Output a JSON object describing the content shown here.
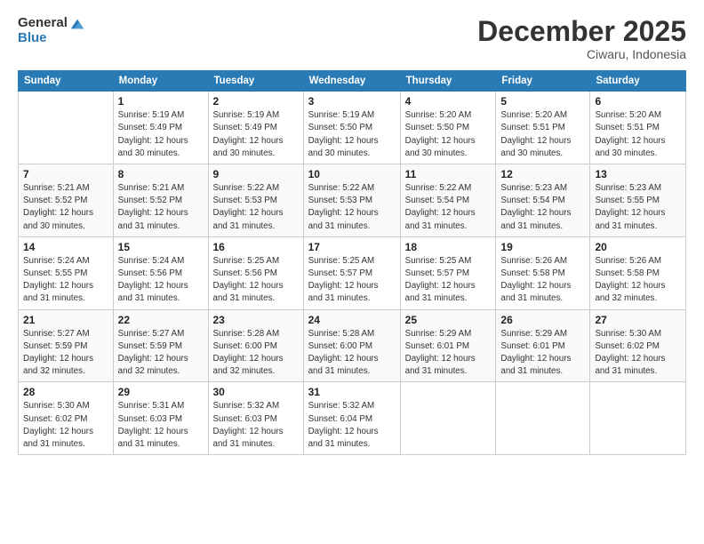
{
  "logo": {
    "general": "General",
    "blue": "Blue"
  },
  "header": {
    "month": "December 2025",
    "location": "Ciwaru, Indonesia"
  },
  "weekdays": [
    "Sunday",
    "Monday",
    "Tuesday",
    "Wednesday",
    "Thursday",
    "Friday",
    "Saturday"
  ],
  "weeks": [
    [
      {
        "day": "",
        "info": ""
      },
      {
        "day": "1",
        "info": "Sunrise: 5:19 AM\nSunset: 5:49 PM\nDaylight: 12 hours\nand 30 minutes."
      },
      {
        "day": "2",
        "info": "Sunrise: 5:19 AM\nSunset: 5:49 PM\nDaylight: 12 hours\nand 30 minutes."
      },
      {
        "day": "3",
        "info": "Sunrise: 5:19 AM\nSunset: 5:50 PM\nDaylight: 12 hours\nand 30 minutes."
      },
      {
        "day": "4",
        "info": "Sunrise: 5:20 AM\nSunset: 5:50 PM\nDaylight: 12 hours\nand 30 minutes."
      },
      {
        "day": "5",
        "info": "Sunrise: 5:20 AM\nSunset: 5:51 PM\nDaylight: 12 hours\nand 30 minutes."
      },
      {
        "day": "6",
        "info": "Sunrise: 5:20 AM\nSunset: 5:51 PM\nDaylight: 12 hours\nand 30 minutes."
      }
    ],
    [
      {
        "day": "7",
        "info": "Sunrise: 5:21 AM\nSunset: 5:52 PM\nDaylight: 12 hours\nand 30 minutes."
      },
      {
        "day": "8",
        "info": "Sunrise: 5:21 AM\nSunset: 5:52 PM\nDaylight: 12 hours\nand 31 minutes."
      },
      {
        "day": "9",
        "info": "Sunrise: 5:22 AM\nSunset: 5:53 PM\nDaylight: 12 hours\nand 31 minutes."
      },
      {
        "day": "10",
        "info": "Sunrise: 5:22 AM\nSunset: 5:53 PM\nDaylight: 12 hours\nand 31 minutes."
      },
      {
        "day": "11",
        "info": "Sunrise: 5:22 AM\nSunset: 5:54 PM\nDaylight: 12 hours\nand 31 minutes."
      },
      {
        "day": "12",
        "info": "Sunrise: 5:23 AM\nSunset: 5:54 PM\nDaylight: 12 hours\nand 31 minutes."
      },
      {
        "day": "13",
        "info": "Sunrise: 5:23 AM\nSunset: 5:55 PM\nDaylight: 12 hours\nand 31 minutes."
      }
    ],
    [
      {
        "day": "14",
        "info": "Sunrise: 5:24 AM\nSunset: 5:55 PM\nDaylight: 12 hours\nand 31 minutes."
      },
      {
        "day": "15",
        "info": "Sunrise: 5:24 AM\nSunset: 5:56 PM\nDaylight: 12 hours\nand 31 minutes."
      },
      {
        "day": "16",
        "info": "Sunrise: 5:25 AM\nSunset: 5:56 PM\nDaylight: 12 hours\nand 31 minutes."
      },
      {
        "day": "17",
        "info": "Sunrise: 5:25 AM\nSunset: 5:57 PM\nDaylight: 12 hours\nand 31 minutes."
      },
      {
        "day": "18",
        "info": "Sunrise: 5:25 AM\nSunset: 5:57 PM\nDaylight: 12 hours\nand 31 minutes."
      },
      {
        "day": "19",
        "info": "Sunrise: 5:26 AM\nSunset: 5:58 PM\nDaylight: 12 hours\nand 31 minutes."
      },
      {
        "day": "20",
        "info": "Sunrise: 5:26 AM\nSunset: 5:58 PM\nDaylight: 12 hours\nand 32 minutes."
      }
    ],
    [
      {
        "day": "21",
        "info": "Sunrise: 5:27 AM\nSunset: 5:59 PM\nDaylight: 12 hours\nand 32 minutes."
      },
      {
        "day": "22",
        "info": "Sunrise: 5:27 AM\nSunset: 5:59 PM\nDaylight: 12 hours\nand 32 minutes."
      },
      {
        "day": "23",
        "info": "Sunrise: 5:28 AM\nSunset: 6:00 PM\nDaylight: 12 hours\nand 32 minutes."
      },
      {
        "day": "24",
        "info": "Sunrise: 5:28 AM\nSunset: 6:00 PM\nDaylight: 12 hours\nand 31 minutes."
      },
      {
        "day": "25",
        "info": "Sunrise: 5:29 AM\nSunset: 6:01 PM\nDaylight: 12 hours\nand 31 minutes."
      },
      {
        "day": "26",
        "info": "Sunrise: 5:29 AM\nSunset: 6:01 PM\nDaylight: 12 hours\nand 31 minutes."
      },
      {
        "day": "27",
        "info": "Sunrise: 5:30 AM\nSunset: 6:02 PM\nDaylight: 12 hours\nand 31 minutes."
      }
    ],
    [
      {
        "day": "28",
        "info": "Sunrise: 5:30 AM\nSunset: 6:02 PM\nDaylight: 12 hours\nand 31 minutes."
      },
      {
        "day": "29",
        "info": "Sunrise: 5:31 AM\nSunset: 6:03 PM\nDaylight: 12 hours\nand 31 minutes."
      },
      {
        "day": "30",
        "info": "Sunrise: 5:32 AM\nSunset: 6:03 PM\nDaylight: 12 hours\nand 31 minutes."
      },
      {
        "day": "31",
        "info": "Sunrise: 5:32 AM\nSunset: 6:04 PM\nDaylight: 12 hours\nand 31 minutes."
      },
      {
        "day": "",
        "info": ""
      },
      {
        "day": "",
        "info": ""
      },
      {
        "day": "",
        "info": ""
      }
    ]
  ]
}
